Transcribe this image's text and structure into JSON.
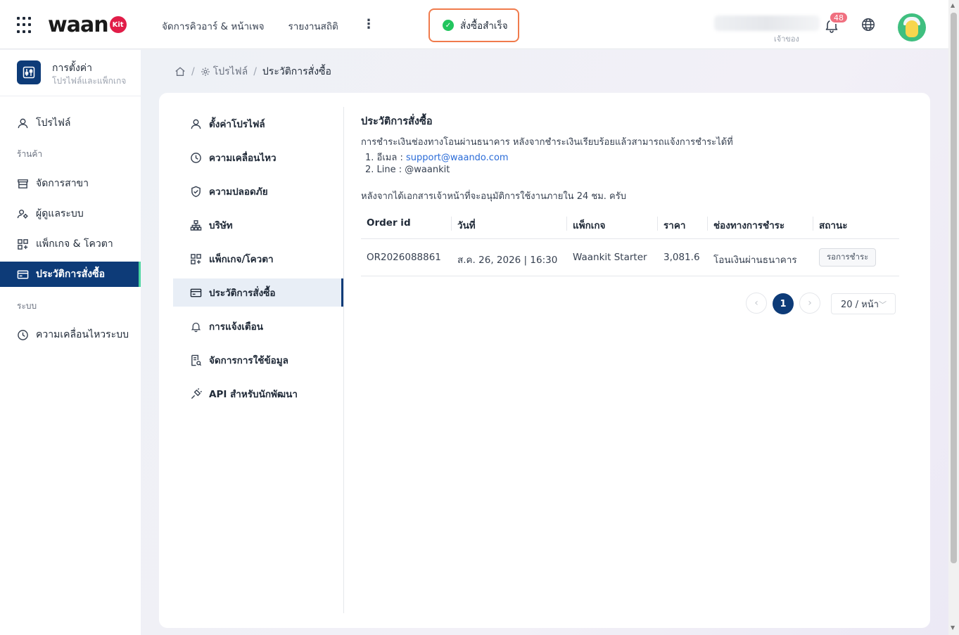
{
  "app": {
    "logo_text": "waan",
    "logo_badge": "Kit"
  },
  "topnav": {
    "items": [
      "จัดการคิวอาร์ & หน้าเพจ",
      "รายงานสถิติ"
    ],
    "more": "⋮"
  },
  "toast": {
    "message": "สั่งซื้อสำเร็จ"
  },
  "user": {
    "role": "เจ้าของ",
    "notification_count": "48"
  },
  "sidebar": {
    "header_title": "การตั้งค่า",
    "header_subtitle": "โปรไฟล์และแพ็กเกจ",
    "profile": "โปรไฟล์",
    "section_store": "ร้านค้า",
    "branches": "จัดการสาขา",
    "admins": "ผู้ดูแลระบบ",
    "packages": "แพ็กเกจ & โควตา",
    "orders": "ประวัติการสั่งซื้อ",
    "section_system": "ระบบ",
    "system_activity": "ความเคลื่อนไหวระบบ"
  },
  "breadcrumb": {
    "profile": "โปรไฟล์",
    "sep": "/",
    "current": "ประวัติการสั่งซื้อ"
  },
  "inner_menu": {
    "profile_settings": "ตั้งค่าโปรไฟล์",
    "activity": "ความเคลื่อนไหว",
    "security": "ความปลอดภัย",
    "company": "บริษัท",
    "package_quota": "แพ็กเกจ/โควตา",
    "order_history": "ประวัติการสั่งซื้อ",
    "notifications": "การแจ้งเตือน",
    "data_management": "จัดการการใช้ข้อมูล",
    "developer_api": "API สำหรับนักพัฒนา"
  },
  "content": {
    "title": "ประวัติการสั่งซื้อ",
    "intro": "การชำระเงินช่องทางโอนผ่านธนาคาร หลังจากชำระเงินเรียบร้อยแล้วสามารถแจ้งการชำระได้ที่",
    "email_prefix": "1.  อีเมล : ",
    "email": "support@waando.com",
    "line": "2.  Line : @waankit",
    "note": "หลังจากได้เอกสารเจ้าหน้าที่จะอนุมัติการใช้งานภายใน 24 ชม. ครับ"
  },
  "table": {
    "headers": {
      "order_id": "Order id",
      "date": "วันที่",
      "package": "แพ็กเกจ",
      "price": "ราคา",
      "channel": "ช่องทางการชำระ",
      "status": "สถานะ"
    },
    "rows": [
      {
        "order_id": "OR2026088861",
        "date": "ส.ค. 26, 2026 | 16:30",
        "package": "Waankit Starter",
        "price": "3,081.6",
        "channel": "โอนเงินผ่านธนาคาร",
        "status": "รอการชำระ"
      }
    ]
  },
  "pagination": {
    "prev": "‹",
    "current": "1",
    "next": "›",
    "page_size": "20 / หน้า"
  },
  "colors": {
    "brand": "#0d3b78",
    "accent": "#4cd6a0",
    "toast_border": "#f07b4c",
    "success": "#22c55e",
    "badge": "#f07080",
    "link": "#2b6cd8"
  }
}
